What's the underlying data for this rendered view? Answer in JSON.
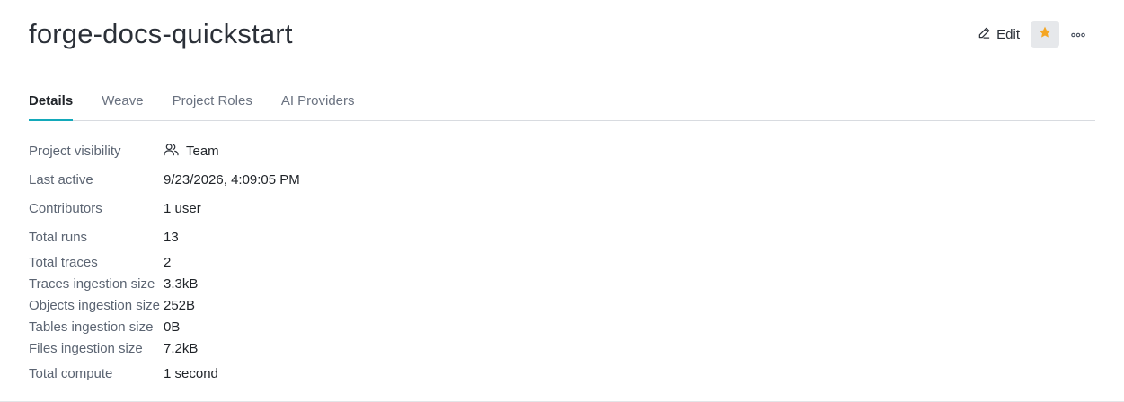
{
  "header": {
    "title": "forge-docs-quickstart",
    "edit_label": "Edit"
  },
  "tabs": [
    {
      "label": "Details",
      "active": true
    },
    {
      "label": "Weave",
      "active": false
    },
    {
      "label": "Project Roles",
      "active": false
    },
    {
      "label": "AI Providers",
      "active": false
    }
  ],
  "details": {
    "visibility": {
      "label": "Project visibility",
      "value": "Team",
      "icon": "users-icon"
    },
    "last_active": {
      "label": "Last active",
      "value": "9/23/2026, 4:09:05 PM"
    },
    "contributors": {
      "label": "Contributors",
      "value": "1 user"
    },
    "total_runs": {
      "label": "Total runs",
      "value": "13"
    },
    "total_traces": {
      "label": "Total traces",
      "value": "2"
    },
    "traces_ingestion": {
      "label": "Traces ingestion size",
      "value": "3.3kB"
    },
    "objects_ingestion": {
      "label": "Objects ingestion size",
      "value": "252B"
    },
    "tables_ingestion": {
      "label": "Tables ingestion size",
      "value": "0B"
    },
    "files_ingestion": {
      "label": "Files ingestion size",
      "value": "7.2kB"
    },
    "total_compute": {
      "label": "Total compute",
      "value": "1 second"
    }
  },
  "colors": {
    "accent": "#13a9ba",
    "star": "#f5a623",
    "star_bg": "#e6e8eb"
  }
}
